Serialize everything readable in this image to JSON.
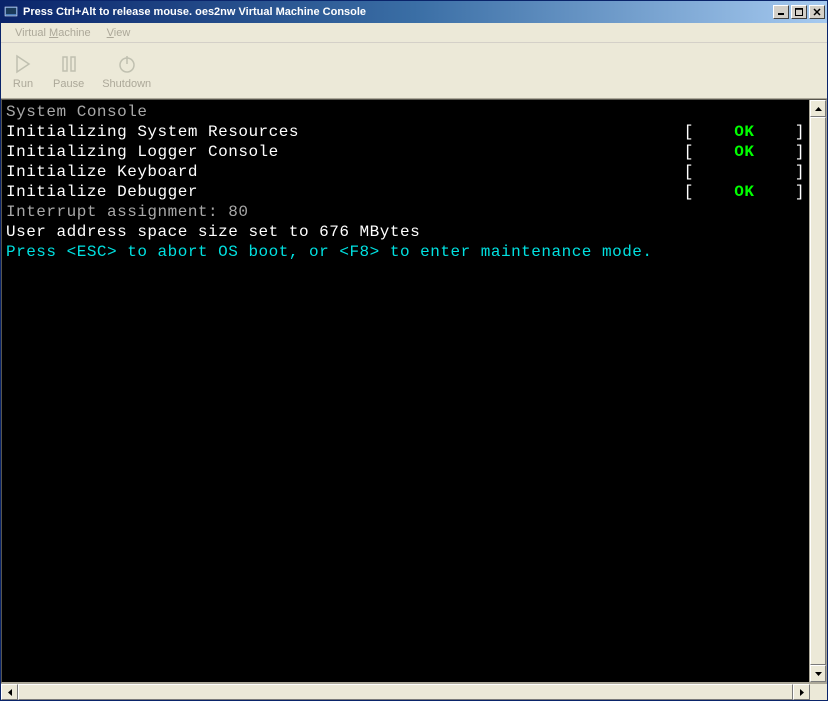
{
  "titlebar": {
    "text": "Press Ctrl+Alt to release mouse. oes2nw Virtual Machine Console"
  },
  "menubar": {
    "virtual_machine": "Virtual Machine",
    "view": "View"
  },
  "toolbar": {
    "run": "Run",
    "pause": "Pause",
    "shutdown": "Shutdown"
  },
  "console": {
    "header": "System Console",
    "lines": [
      {
        "text": "Initializing System Resources",
        "status": "OK"
      },
      {
        "text": "Initializing Logger Console",
        "status": "OK"
      },
      {
        "text": "Initialize Keyboard",
        "status": ""
      },
      {
        "text": "Initialize Debugger",
        "status": "OK"
      }
    ],
    "interrupt": "Interrupt assignment: 80",
    "user_space": "User address space size set to 676 MBytes",
    "prompt": "Press <ESC> to abort OS boot, or <F8> to enter maintenance mode."
  }
}
